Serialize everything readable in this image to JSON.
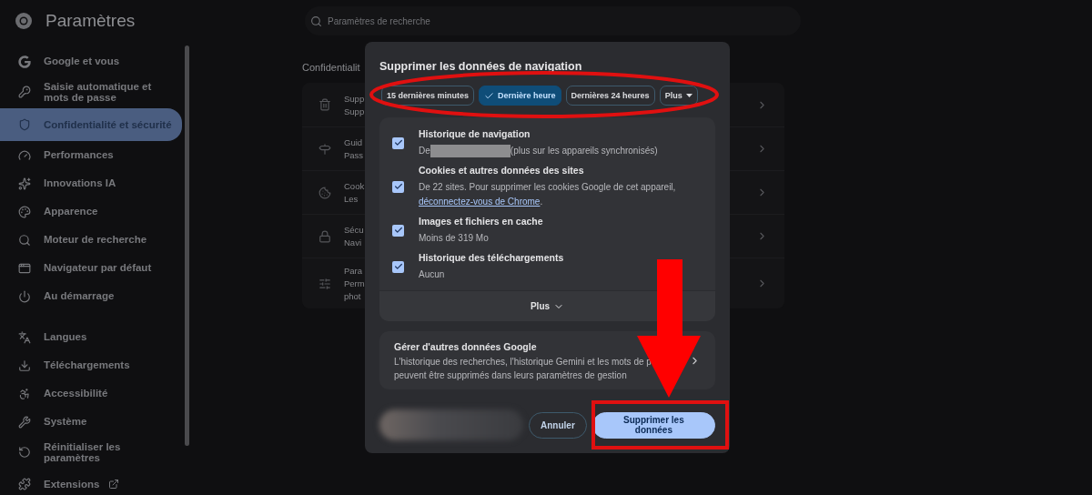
{
  "header": {
    "title": "Paramètres",
    "search_placeholder": "Paramètres de recherche"
  },
  "sidebar": {
    "groups": [
      [
        {
          "label": "Google et vous",
          "selected": false
        },
        {
          "label": "Saisie automatique et mots de passe",
          "selected": false
        },
        {
          "label": "Confidentialité et sécurité",
          "selected": true
        },
        {
          "label": "Performances",
          "selected": false
        },
        {
          "label": "Innovations IA",
          "selected": false
        },
        {
          "label": "Apparence",
          "selected": false
        },
        {
          "label": "Moteur de recherche",
          "selected": false
        },
        {
          "label": "Navigateur par défaut",
          "selected": false
        },
        {
          "label": "Au démarrage",
          "selected": false
        }
      ],
      [
        {
          "label": "Langues",
          "selected": false
        },
        {
          "label": "Téléchargements",
          "selected": false
        },
        {
          "label": "Accessibilité",
          "selected": false
        },
        {
          "label": "Système",
          "selected": false
        },
        {
          "label": "Réinitialiser les paramètres",
          "selected": false
        }
      ],
      [
        {
          "label": "Extensions",
          "selected": false
        }
      ]
    ]
  },
  "main": {
    "heading": "Confidentialit",
    "rows": [
      {
        "lines": [
          "Supp",
          "Supp"
        ]
      },
      {
        "lines": [
          "Guid",
          "Pass"
        ]
      },
      {
        "lines": [
          "Cook",
          "Les"
        ]
      },
      {
        "lines": [
          "Sécu",
          "Navi"
        ]
      },
      {
        "lines": [
          "Para",
          "Perm",
          "phot"
        ]
      }
    ]
  },
  "dialog": {
    "title": "Supprimer les données de navigation",
    "ranges": [
      {
        "label": "15 dernières minutes",
        "selected": false,
        "kind": "chip"
      },
      {
        "label": "Dernière heure",
        "selected": true,
        "kind": "chip"
      },
      {
        "label": "Dernières 24 heures",
        "selected": false,
        "kind": "chip"
      },
      {
        "label": "Plus",
        "selected": false,
        "kind": "dropdown"
      }
    ],
    "items": [
      {
        "title": "Historique de navigation",
        "description": "De",
        "redacted": true,
        "suffix": "(plus sur les appareils synchronisés)",
        "checked": true
      },
      {
        "title": "Cookies et autres données des sites",
        "description": "De 22 sites. Pour supprimer les cookies Google de cet appareil,",
        "link": "déconnectez-vous de Chrome",
        "suffix": ".",
        "checked": true
      },
      {
        "title": "Images et fichiers en cache",
        "description": "Moins de 319 Mo",
        "checked": true
      },
      {
        "title": "Historique des téléchargements",
        "description": "Aucun",
        "checked": true
      }
    ],
    "more_label": "Plus",
    "manage": {
      "title": "Gérer d'autres données Google",
      "description": "L'historique des recherches, l'historique Gemini et les mots de p",
      "description_2": "peuvent être supprimés dans leurs paramètres de gestion"
    },
    "cancel": "Annuler",
    "confirm": "Supprimer les données"
  }
}
